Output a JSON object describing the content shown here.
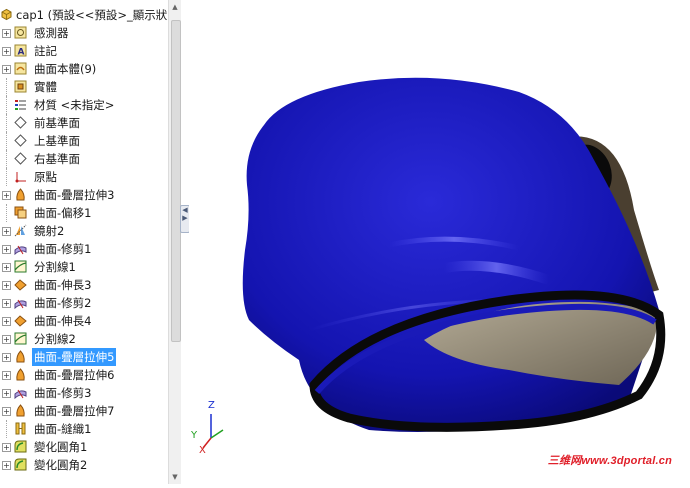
{
  "tree": {
    "root_label": "cap1  (預設<<預設>_顯示狀",
    "items": [
      {
        "label": "感測器",
        "icon": "sensor-icon",
        "expandable": true
      },
      {
        "label": "註記",
        "icon": "annotation-icon",
        "expandable": true
      },
      {
        "label": "曲面本體(9)",
        "icon": "surface-bodies-icon",
        "expandable": true
      },
      {
        "label": "實體",
        "icon": "solid-bodies-icon",
        "expandable": false
      },
      {
        "label": "材質 <未指定>",
        "icon": "material-icon",
        "expandable": false
      },
      {
        "label": "前基準面",
        "icon": "plane-icon",
        "expandable": false
      },
      {
        "label": "上基準面",
        "icon": "plane-icon",
        "expandable": false
      },
      {
        "label": "右基準面",
        "icon": "plane-icon",
        "expandable": false
      },
      {
        "label": "原點",
        "icon": "origin-icon",
        "expandable": false
      },
      {
        "label": "曲面-疊層拉伸3",
        "icon": "surface-loft-icon",
        "expandable": true
      },
      {
        "label": "曲面-偏移1",
        "icon": "surface-offset-icon",
        "expandable": false
      },
      {
        "label": "鏡射2",
        "icon": "mirror-icon",
        "expandable": true
      },
      {
        "label": "曲面-修剪1",
        "icon": "surface-trim-icon",
        "expandable": true
      },
      {
        "label": "分割線1",
        "icon": "split-line-icon",
        "expandable": true
      },
      {
        "label": "曲面-伸長3",
        "icon": "surface-extend-icon",
        "expandable": true
      },
      {
        "label": "曲面-修剪2",
        "icon": "surface-trim-icon",
        "expandable": true
      },
      {
        "label": "曲面-伸長4",
        "icon": "surface-extend-icon",
        "expandable": true
      },
      {
        "label": "分割線2",
        "icon": "split-line-icon",
        "expandable": true
      },
      {
        "label": "曲面-疊層拉伸5",
        "icon": "surface-loft-icon",
        "expandable": true,
        "selected": true
      },
      {
        "label": "曲面-疊層拉伸6",
        "icon": "surface-loft-icon",
        "expandable": true
      },
      {
        "label": "曲面-修剪3",
        "icon": "surface-trim-icon",
        "expandable": true
      },
      {
        "label": "曲面-疊層拉伸7",
        "icon": "surface-loft-icon",
        "expandable": true
      },
      {
        "label": "曲面-縫織1",
        "icon": "surface-knit-icon",
        "expandable": false
      },
      {
        "label": "變化圓角1",
        "icon": "variable-fillet-icon",
        "expandable": true
      },
      {
        "label": "變化圓角2",
        "icon": "variable-fillet-icon",
        "expandable": true
      }
    ]
  },
  "triad": {
    "x_label": "X",
    "y_label": "Y",
    "z_label": "Z"
  },
  "watermark": "三维网www.3dportal.cn",
  "colors": {
    "model_blue": "#1a1ab8",
    "model_band": "#0a0a0a",
    "inner_tan": "#8a7e6a",
    "selection": "#3399ff",
    "watermark": "#e0202a"
  }
}
